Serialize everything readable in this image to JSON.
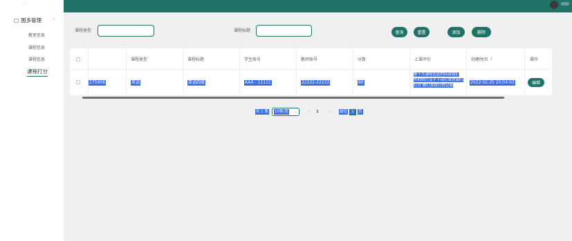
{
  "sidebar": {
    "cutoff_text": "...",
    "group_label": "图多管理",
    "items": [
      "教室信息",
      "课程信息",
      "课程信息"
    ],
    "active_item": "课程打分"
  },
  "search": {
    "course_type_label": "课程类型",
    "course_type_value": "",
    "course_title_label": "课程标题",
    "course_title_value": "",
    "buttons": {
      "query": "查询",
      "reset": "重置",
      "add": "添加",
      "delete": "删除"
    }
  },
  "table": {
    "headers": [
      "",
      "课程类型",
      "课程标题",
      "学生账号",
      "教师账号",
      "分数",
      "上课评价",
      "创建时间",
      "操作"
    ],
    "sort_indicator": "↕",
    "rows": [
      {
        "id": "275908",
        "course_type": "英语",
        "course_title": "英语四级",
        "student_account": "AAA - 11111",
        "teacher_account": "22222-22222",
        "score": "80",
        "evaluation": "第十大课程在此的四部我们 件的的打活于下动打发的我们打分 数打发程打的记录",
        "created_time": "2022-02-25 20:04:03",
        "action": "编辑"
      }
    ]
  },
  "pagination": {
    "total": "共 1 条",
    "page_size": "10条/页",
    "prev": "<",
    "current_page": "1",
    "next": ">",
    "goto_label": "前往",
    "goto_value": "1",
    "page_suffix": "页"
  },
  "colors": {
    "primary": "#1f7266",
    "highlight": "#3b6fe0",
    "panel": "#f0f0f0"
  }
}
